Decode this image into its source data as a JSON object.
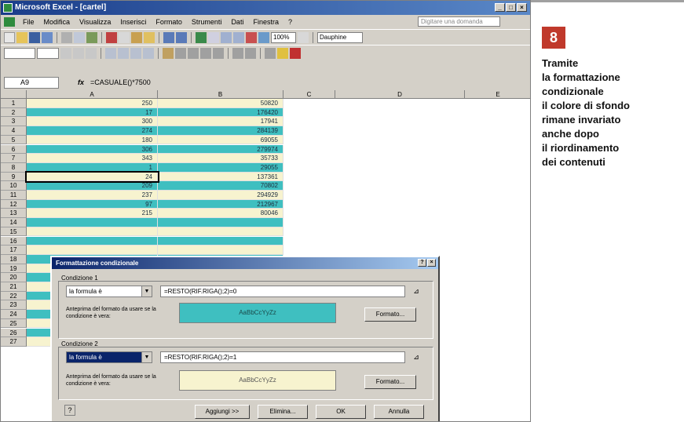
{
  "window": {
    "title": "Microsoft Excel - [cartel]"
  },
  "menubar": {
    "items": [
      "File",
      "Modifica",
      "Visualizza",
      "Inserisci",
      "Formato",
      "Strumenti",
      "Dati",
      "Finestra",
      "?"
    ],
    "help_placeholder": "Digitare una domanda"
  },
  "toolbar": {
    "zoom": "100%",
    "font": "Dauphine"
  },
  "formulabar": {
    "namebox": "A9",
    "fx": "fx",
    "formula": "=CASUALE()*7500"
  },
  "sheet": {
    "columns": [
      "A",
      "B",
      "C",
      "D",
      "E"
    ],
    "rows": [
      {
        "n": "1",
        "a": "250",
        "b": "50820",
        "teal": false
      },
      {
        "n": "2",
        "a": "17",
        "b": "176420",
        "teal": true
      },
      {
        "n": "3",
        "a": "300",
        "b": "17941",
        "teal": false
      },
      {
        "n": "4",
        "a": "274",
        "b": "284139",
        "teal": true
      },
      {
        "n": "5",
        "a": "180",
        "b": "69055",
        "teal": false
      },
      {
        "n": "6",
        "a": "306",
        "b": "279974",
        "teal": true
      },
      {
        "n": "7",
        "a": "343",
        "b": "35733",
        "teal": false
      },
      {
        "n": "8",
        "a": "1",
        "b": "29055",
        "teal": true
      },
      {
        "n": "9",
        "a": "24",
        "b": "137361",
        "teal": false
      },
      {
        "n": "10",
        "a": "209",
        "b": "70802",
        "teal": true
      },
      {
        "n": "11",
        "a": "237",
        "b": "294929",
        "teal": false
      },
      {
        "n": "12",
        "a": "97",
        "b": "212967",
        "teal": true
      },
      {
        "n": "13",
        "a": "215",
        "b": "80046",
        "teal": false
      },
      {
        "n": "14",
        "a": "",
        "b": "",
        "teal": true
      },
      {
        "n": "15",
        "a": "",
        "b": "",
        "teal": false
      },
      {
        "n": "16",
        "a": "",
        "b": "",
        "teal": true
      },
      {
        "n": "17",
        "a": "",
        "b": "",
        "teal": false
      },
      {
        "n": "18",
        "a": "",
        "b": "",
        "teal": true
      },
      {
        "n": "19",
        "a": "",
        "b": "",
        "teal": false
      },
      {
        "n": "20",
        "a": "",
        "b": "",
        "teal": true
      },
      {
        "n": "21",
        "a": "",
        "b": "",
        "teal": false
      },
      {
        "n": "22",
        "a": "",
        "b": "",
        "teal": true
      },
      {
        "n": "23",
        "a": "",
        "b": "",
        "teal": false
      },
      {
        "n": "24",
        "a": "",
        "b": "",
        "teal": true
      },
      {
        "n": "25",
        "a": "",
        "b": "",
        "teal": false
      },
      {
        "n": "26",
        "a": "",
        "b": "",
        "teal": true
      },
      {
        "n": "27",
        "a": "",
        "b": "",
        "teal": false
      }
    ]
  },
  "dialog": {
    "title": "Formattazione condizionale",
    "cond1": {
      "label": "Condizione 1",
      "type": "la formula è",
      "formula": "=RESTO(RIF.RIGA();2)=0",
      "preview_label": "Anteprima del formato da usare se la condizione è vera:",
      "preview_text": "AaBbCcYyZz",
      "format_button": "Formato..."
    },
    "cond2": {
      "label": "Condizione 2",
      "type": "la formula è",
      "formula": "=RESTO(RIF.RIGA();2)=1",
      "preview_label": "Anteprima del formato da usare se la condizione è vera:",
      "preview_text": "AaBbCcYyZz",
      "format_button": "Formato..."
    },
    "buttons": {
      "add": "Aggiungi >>",
      "delete": "Elimina...",
      "ok": "OK",
      "cancel": "Annulla"
    }
  },
  "colors": {
    "teal": "#3fbfc0",
    "cream": "#f7f3cf",
    "badge": "#c0392b"
  },
  "callout": {
    "number": "8",
    "lines": [
      "Tramite",
      "la formattazione",
      "condizionale",
      "il colore di sfondo",
      "rimane invariato",
      "anche dopo",
      "il riordinamento",
      "dei contenuti"
    ]
  }
}
